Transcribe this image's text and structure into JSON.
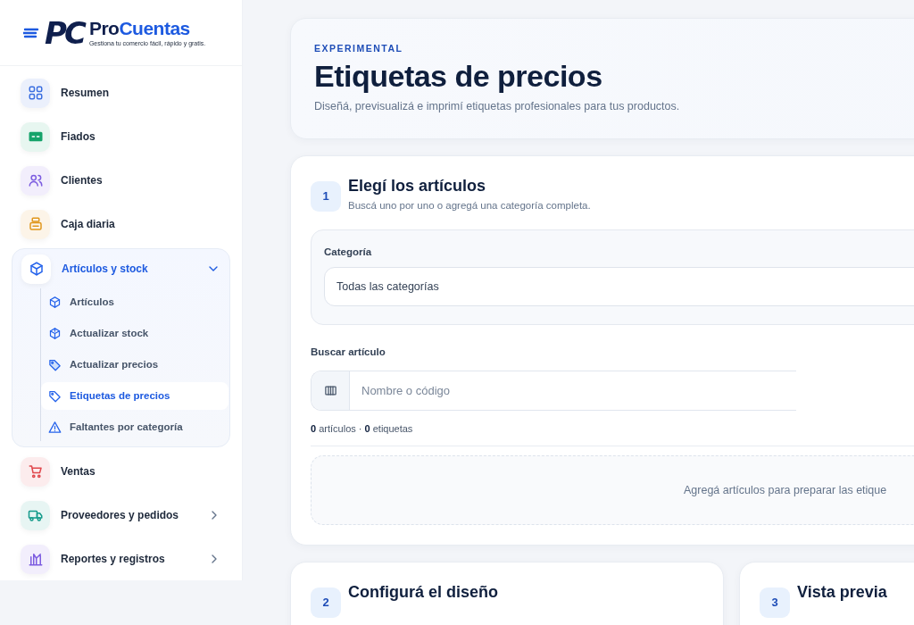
{
  "logo": {
    "mark": "PC",
    "name_first": "Pro",
    "name_second": "Cuentas",
    "tagline": "Gestiona tu comercio fácil, rápido y gratis."
  },
  "sidebar": {
    "items": [
      {
        "label": "Resumen",
        "color": "#3b6fe0",
        "selected": false
      },
      {
        "label": "Fiados",
        "color": "#16a36a",
        "selected": false
      },
      {
        "label": "Clientes",
        "color": "#7c5ce0",
        "selected": false
      },
      {
        "label": "Caja diaria",
        "color": "#e0961b",
        "selected": false
      },
      {
        "label": "Artículos y stock",
        "color": "#2563eb",
        "selected": true,
        "expanded": true,
        "children": [
          {
            "label": "Artículos",
            "selected": false
          },
          {
            "label": "Actualizar stock",
            "selected": false
          },
          {
            "label": "Actualizar precios",
            "selected": false
          },
          {
            "label": "Etiquetas de precios",
            "selected": true
          },
          {
            "label": "Faltantes por categoría",
            "selected": false
          }
        ]
      },
      {
        "label": "Ventas",
        "color": "#e0474c",
        "selected": false
      },
      {
        "label": "Proveedores y pedidos",
        "color": "#139a8a",
        "selected": false,
        "expanded": false
      },
      {
        "label": "Reportes y registros",
        "color": "#7c5ce0",
        "selected": false,
        "expanded": false
      }
    ]
  },
  "header": {
    "eyebrow": "EXPERIMENTAL",
    "title": "Etiquetas de precios",
    "subtitle": "Diseñá, previsualizá e imprimí etiquetas profesionales para tus productos."
  },
  "step1": {
    "number": "1",
    "title": "Elegí los artículos",
    "subtitle": "Buscá uno por uno o agregá una categoría completa.",
    "category": {
      "label": "Categoría",
      "value": "Todas las categorías"
    },
    "search": {
      "label": "Buscar artículo",
      "placeholder": "Nombre o código"
    },
    "counts": "**0** artículos · **0** etiquetas",
    "empty_message": "Agregá artículos para preparar las etique"
  },
  "step2": {
    "number": "2",
    "title": "Configurá el diseño"
  },
  "step3": {
    "number": "3",
    "title": "Vista previa"
  }
}
